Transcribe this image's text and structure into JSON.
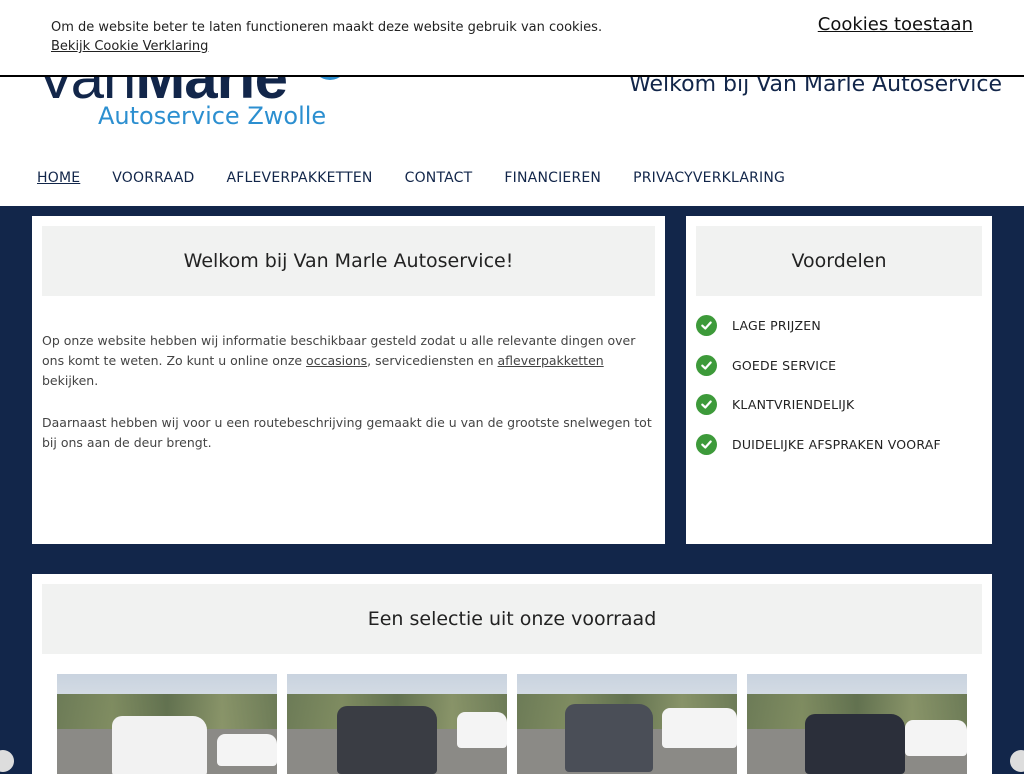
{
  "cookie": {
    "text": "Om de website beter te laten functioneren maakt deze website gebruik van cookies.",
    "link": "Bekijk Cookie Verklaring",
    "button": "Cookies toestaan"
  },
  "header": {
    "logo_main_van": "Van",
    "logo_main_marle": "Marle",
    "logo_sub": "Autoservice Zwolle",
    "welcome": "Welkom bij Van Marle Autoservice"
  },
  "nav": [
    "HOME",
    "VOORRAAD",
    "AFLEVERPAKKETTEN",
    "CONTACT",
    "FINANCIEREN",
    "PRIVACYVERKLARING"
  ],
  "intro": {
    "title": "Welkom bij Van Marle Autoservice!",
    "p1_a": "Op onze website hebben wij informatie beschikbaar gesteld zodat u alle relevante dingen over ons komt te weten. Zo kunt u online onze ",
    "p1_link1": "occasions",
    "p1_b": ", servicediensten en ",
    "p1_link2": "afleverpakketten ",
    "p1_c": "bekijken.",
    "p2": "Daarnaast hebben wij voor u een routebeschrijving gemaakt die u van de grootste snelwegen tot bij ons aan de deur brengt."
  },
  "advantages": {
    "title": "Voordelen",
    "items": [
      "LAGE PRIJZEN",
      "GOEDE SERVICE",
      "KLANTVRIENDELIJK",
      "DUIDELIJKE AFSPRAKEN VOORAF"
    ]
  },
  "stock": {
    "title": "Een selectie uit onze voorraad",
    "cars": [
      {
        "body_color": "#f2f2f2"
      },
      {
        "body_color": "#3a3d44"
      },
      {
        "body_color": "#4a4e57"
      },
      {
        "body_color": "#2b2f3a"
      }
    ]
  },
  "colors": {
    "navy": "#12264a",
    "accent_blue": "#2c8fd0",
    "check_green": "#3d9a3a"
  }
}
